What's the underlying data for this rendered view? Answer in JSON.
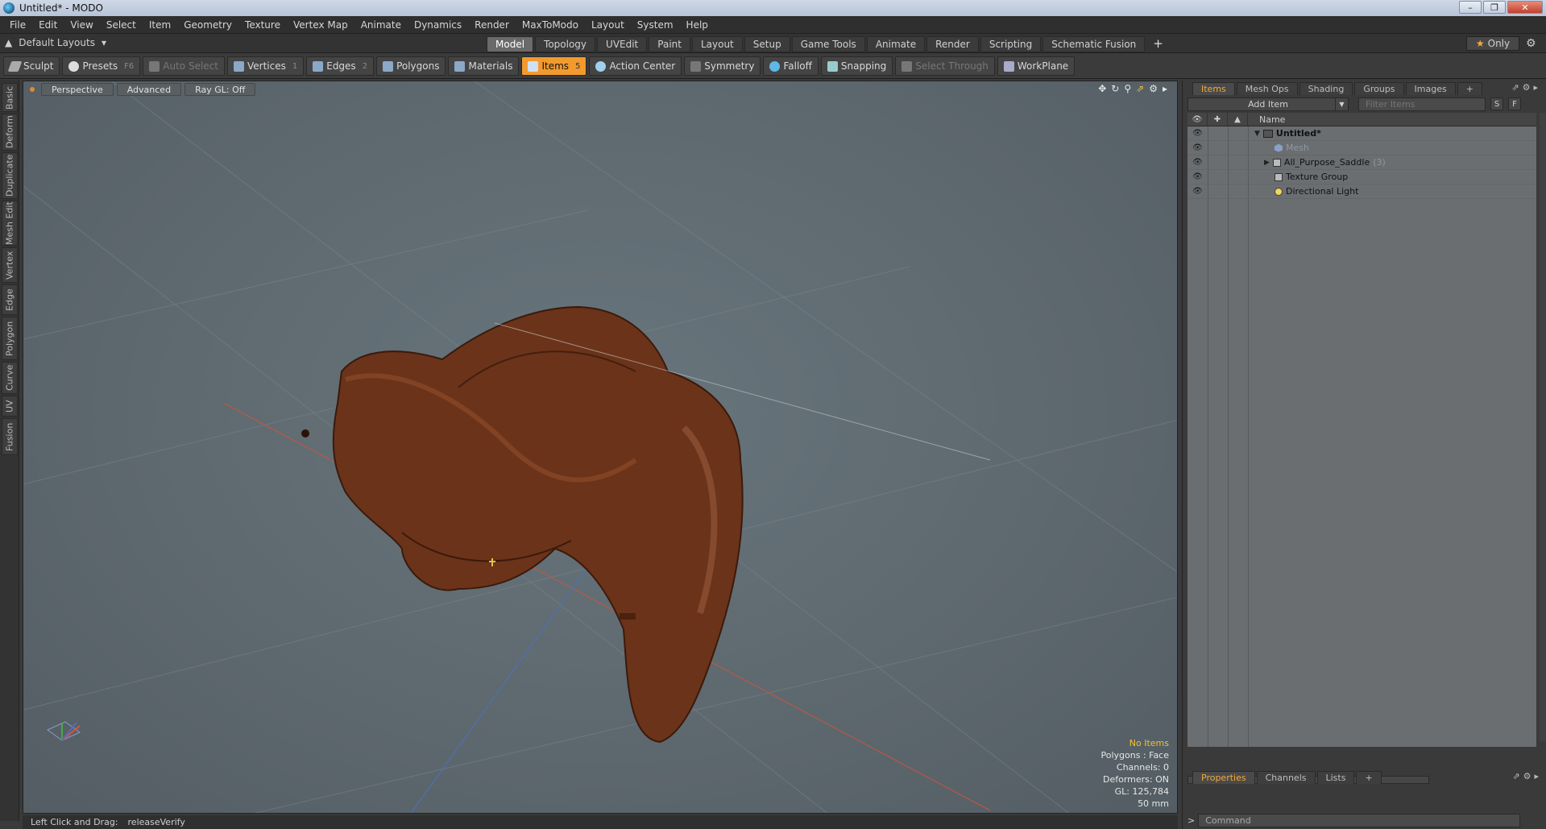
{
  "window": {
    "title": "Untitled* - MODO"
  },
  "menu": [
    "File",
    "Edit",
    "View",
    "Select",
    "Item",
    "Geometry",
    "Texture",
    "Vertex Map",
    "Animate",
    "Dynamics",
    "Render",
    "MaxToModo",
    "Layout",
    "System",
    "Help"
  ],
  "layouts": {
    "label": "Default Layouts",
    "tabs": [
      "Model",
      "Topology",
      "UVEdit",
      "Paint",
      "Layout",
      "Setup",
      "Game Tools",
      "Animate",
      "Render",
      "Scripting",
      "Schematic Fusion"
    ],
    "active": "Model",
    "only_label": "Only"
  },
  "toolbar": {
    "sculpt": "Sculpt",
    "presets": "Presets",
    "presets_key": "F6",
    "auto_select": "Auto Select",
    "vertices": "Vertices",
    "vertices_key": "1",
    "edges": "Edges",
    "edges_key": "2",
    "polygons": "Polygons",
    "materials": "Materials",
    "items": "Items",
    "items_key": "5",
    "action_center": "Action Center",
    "symmetry": "Symmetry",
    "falloff": "Falloff",
    "snapping": "Snapping",
    "select_through": "Select Through",
    "workplane": "WorkPlane"
  },
  "left_tabs": [
    "Basic",
    "Deform",
    "Duplicate",
    "Mesh Edit",
    "Vertex",
    "Edge",
    "Polygon",
    "Curve",
    "UV",
    "Fusion"
  ],
  "viewport": {
    "view": "Perspective",
    "mode": "Advanced",
    "raygl": "Ray GL: Off",
    "info": {
      "items": "No Items",
      "polygons": "Polygons : Face",
      "channels": "Channels: 0",
      "deformers": "Deformers: ON",
      "gl": "GL: 125,784",
      "scale": "50 mm"
    }
  },
  "status": {
    "hint": "Left Click and Drag:",
    "action": "releaseVerify"
  },
  "items_panel": {
    "tabs": [
      "Items",
      "Mesh Ops",
      "Shading",
      "Groups",
      "Images"
    ],
    "active": "Items",
    "add_item": "Add Item",
    "filter_placeholder": "Filter Items",
    "s_btn": "S",
    "f_btn": "F",
    "name_col": "Name",
    "tree": [
      {
        "name": "Untitled*",
        "kind": "scene"
      },
      {
        "name": "Mesh",
        "kind": "mesh"
      },
      {
        "name": "All_Purpose_Saddle",
        "count": "(3)",
        "kind": "group"
      },
      {
        "name": "Texture Group",
        "kind": "group"
      },
      {
        "name": "Directional Light",
        "kind": "light"
      }
    ]
  },
  "properties_panel": {
    "tabs": [
      "Properties",
      "Channels",
      "Lists"
    ],
    "active": "Properties"
  },
  "command": {
    "placeholder": "Command"
  },
  "colors": {
    "accent": "#f29a2e",
    "saddle": "#6b3319",
    "viewport_bg": "#5e6a70"
  }
}
